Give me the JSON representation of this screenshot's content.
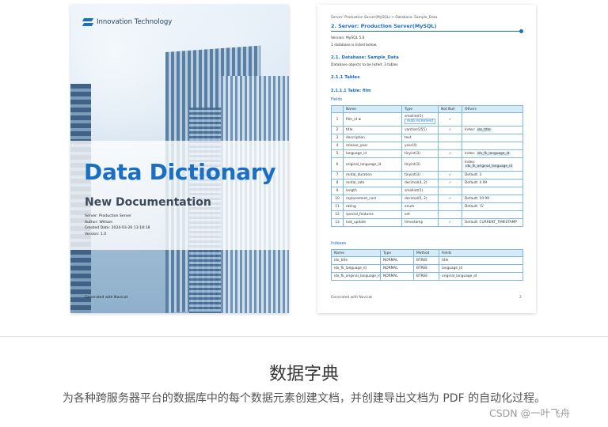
{
  "cover": {
    "brand": "Innovation Technology",
    "title": "Data Dictionary",
    "subtitle": "New Documentation",
    "server": "Server: Production Server",
    "author": "Author: William",
    "created": "Created Date: 2024-03-26 13:18:18",
    "version": "Version: 1.0",
    "generated": "Generated with Navicat"
  },
  "doc": {
    "breadcrumb": "Server: Production Server(MySQL) > Database: Sample_Data",
    "heading": "2.  Server: Production Server(MySQL)",
    "version": "Version: MySQL 5.6",
    "db_count": "1 database is listed below.",
    "db_heading": "2.1. Database: Sample_Data",
    "db_objects": "Database objects to be listed: 3 tables",
    "tables_heading": "2.1.1 Tables",
    "table_heading": "2.1.1.1 Table: film",
    "fields_label": "Fields",
    "fields_columns": [
      "",
      "Name",
      "Type",
      "Not Null",
      "Others"
    ],
    "fields": [
      {
        "n": "1",
        "name": "film_id ★",
        "type": "smallint(5)",
        "type_tag": "Auto increment",
        "nn": "✓",
        "others": "",
        "others_hl": ""
      },
      {
        "n": "2",
        "name": "title",
        "type": "varchar(255)",
        "type_tag": "",
        "nn": "✓",
        "others": "Index: ",
        "others_hl": "idx_title"
      },
      {
        "n": "3",
        "name": "description",
        "type": "text",
        "type_tag": "",
        "nn": "",
        "others": "",
        "others_hl": ""
      },
      {
        "n": "4",
        "name": "release_year",
        "type": "year(4)",
        "type_tag": "",
        "nn": "",
        "others": "",
        "others_hl": ""
      },
      {
        "n": "5",
        "name": "language_id",
        "type": "tinyint(3)",
        "type_tag": "",
        "nn": "✓",
        "others": "Index: ",
        "others_hl": "idx_fk_language_id"
      },
      {
        "n": "6",
        "name": "original_language_id",
        "type": "tinyint(3)",
        "type_tag": "",
        "nn": "",
        "others": "Index:",
        "others_hl": "idx_fk_original_language_id"
      },
      {
        "n": "7",
        "name": "rental_duration",
        "type": "tinyint(3)",
        "type_tag": "",
        "nn": "✓",
        "others": "Default: 3",
        "others_hl": ""
      },
      {
        "n": "8",
        "name": "rental_rate",
        "type": "decimal(4, 2)",
        "type_tag": "",
        "nn": "✓",
        "others": "Default: 4.99",
        "others_hl": ""
      },
      {
        "n": "9",
        "name": "length",
        "type": "smallint(5)",
        "type_tag": "",
        "nn": "",
        "others": "",
        "others_hl": ""
      },
      {
        "n": "10",
        "name": "replacement_cost",
        "type": "decimal(5, 2)",
        "type_tag": "",
        "nn": "✓",
        "others": "Default: 19.99",
        "others_hl": ""
      },
      {
        "n": "11",
        "name": "rating",
        "type": "enum",
        "type_tag": "",
        "nn": "",
        "others": "Default: 'G'",
        "others_hl": ""
      },
      {
        "n": "12",
        "name": "special_features",
        "type": "set",
        "type_tag": "",
        "nn": "",
        "others": "",
        "others_hl": ""
      },
      {
        "n": "13",
        "name": "last_update",
        "type": "timestamp",
        "type_tag": "",
        "nn": "✓",
        "others": "Default: CURRENT_TIMESTAMP",
        "others_hl": ""
      }
    ],
    "indexes_label": "Indexes",
    "index_columns": [
      "Name",
      "Type",
      "Method",
      "Fields"
    ],
    "indexes": [
      {
        "name": "idx_title",
        "type": "NORMAL",
        "method": "BTREE",
        "fields": "title"
      },
      {
        "name": "idx_fk_language_id",
        "type": "NORMAL",
        "method": "BTREE",
        "fields": "language_id"
      },
      {
        "name": "idx_fk_original_language_id",
        "type": "NORMAL",
        "method": "BTREE",
        "fields": "original_language_id"
      }
    ],
    "footer": "Generated with Navicat",
    "page_number": "2"
  },
  "section": {
    "title": "数据字典",
    "description": "为各种跨服务器平台的数据库中的每个数据元素创建文档，并创建导出文档为 PDF 的自动化过程。"
  },
  "watermark": "CSDN @一叶飞舟",
  "colors": {
    "accent": "#1a6fc4",
    "table_border": "#7fb8e0",
    "table_header": "#d6ebf8"
  }
}
